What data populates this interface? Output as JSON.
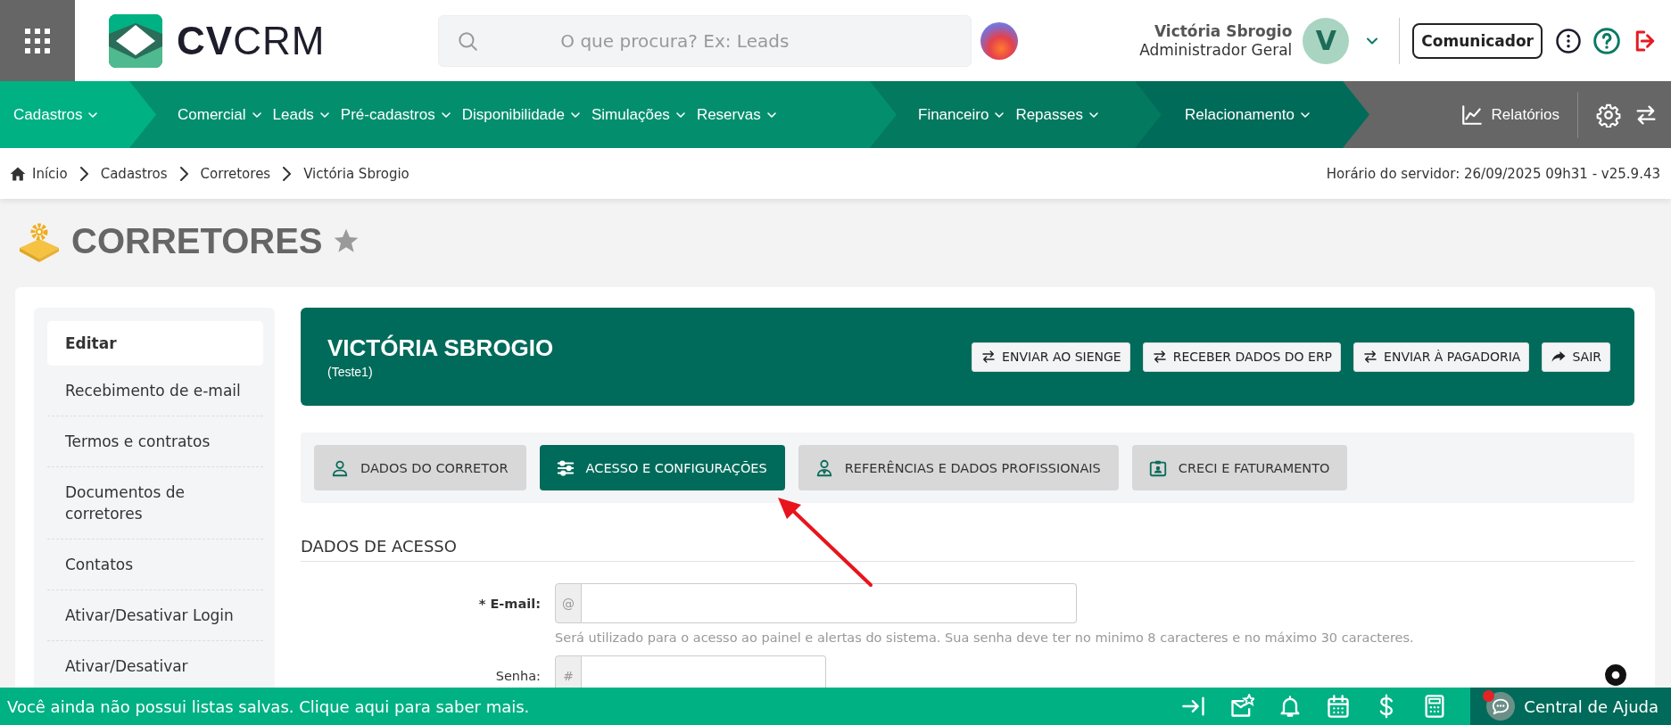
{
  "header": {
    "logo_text": "**CV**CRM",
    "search_placeholder": "O que procura? Ex: Leads",
    "user_name": "Victória Sbrogio",
    "user_role": "Administrador Geral",
    "avatar_initial": "V",
    "communicator_button": "Comunicador"
  },
  "nav": {
    "segments": [
      {
        "color": "#00b184",
        "items": [
          "Cadastros"
        ]
      },
      {
        "color": "#038f6e",
        "items": [
          "Comercial",
          "Leads",
          "Pré-cadastros",
          "Disponibilidade",
          "Simulações",
          "Reservas"
        ]
      },
      {
        "color": "#03795f",
        "items": [
          "Financeiro",
          "Repasses"
        ]
      },
      {
        "color": "#006b59",
        "items": [
          "Relacionamento"
        ]
      }
    ],
    "reports": "Relatórios"
  },
  "breadcrumb": [
    "Início",
    "Cadastros",
    "Corretores",
    "Victória Sbrogio"
  ],
  "server_time": "Horário do servidor: 26/09/2025 09h31 - v25.9.43",
  "page_title": "CORRETORES",
  "sidebar": {
    "items": [
      {
        "label": "Editar",
        "selected": true
      },
      {
        "label": "Recebimento de e-mail",
        "selected": false
      },
      {
        "label": "Termos e contratos",
        "selected": false
      },
      {
        "label": "Documentos de corretores",
        "selected": false
      },
      {
        "label": "Contatos",
        "selected": false
      },
      {
        "label": "Ativar/Desativar Login",
        "selected": false
      },
      {
        "label": "Ativar/Desativar",
        "selected": false
      }
    ]
  },
  "profile": {
    "name": "VICTÓRIA SBROGIO",
    "subtitle": "(Teste1)",
    "actions": [
      {
        "label": "ENVIAR AO SIENGE",
        "kind": "swap"
      },
      {
        "label": "RECEBER DADOS DO ERP",
        "kind": "swap"
      },
      {
        "label": "ENVIAR À PAGADORIA",
        "kind": "swap"
      },
      {
        "label": "SAIR",
        "kind": "share"
      }
    ]
  },
  "tabs": [
    {
      "label": "DADOS DO CORRETOR",
      "kind": "person",
      "selected": false
    },
    {
      "label": "ACESSO E CONFIGURAÇÕES",
      "kind": "sliders",
      "selected": true
    },
    {
      "label": "REFERÊNCIAS E DADOS PROFISSIONAIS",
      "kind": "professional",
      "selected": false
    },
    {
      "label": "CRECI E FATURAMENTO",
      "kind": "badge",
      "selected": false
    }
  ],
  "section_title": "DADOS DE ACESSO",
  "form": {
    "fields": [
      {
        "label": "* E-mail:",
        "required": true,
        "prefix": "@",
        "kind": "email",
        "hint": "Será utilizado para o acesso ao painel e alertas do sistema. Sua senha deve ter no minimo 8 caracteres e no máximo 30 caracteres."
      },
      {
        "label": "Senha:",
        "required": false,
        "prefix": "#",
        "kind": "password"
      }
    ]
  },
  "bottom_bar": {
    "message": "Você ainda não possui listas salvas. Clique aqui para saber mais.",
    "help": "Central de Ajuda"
  }
}
